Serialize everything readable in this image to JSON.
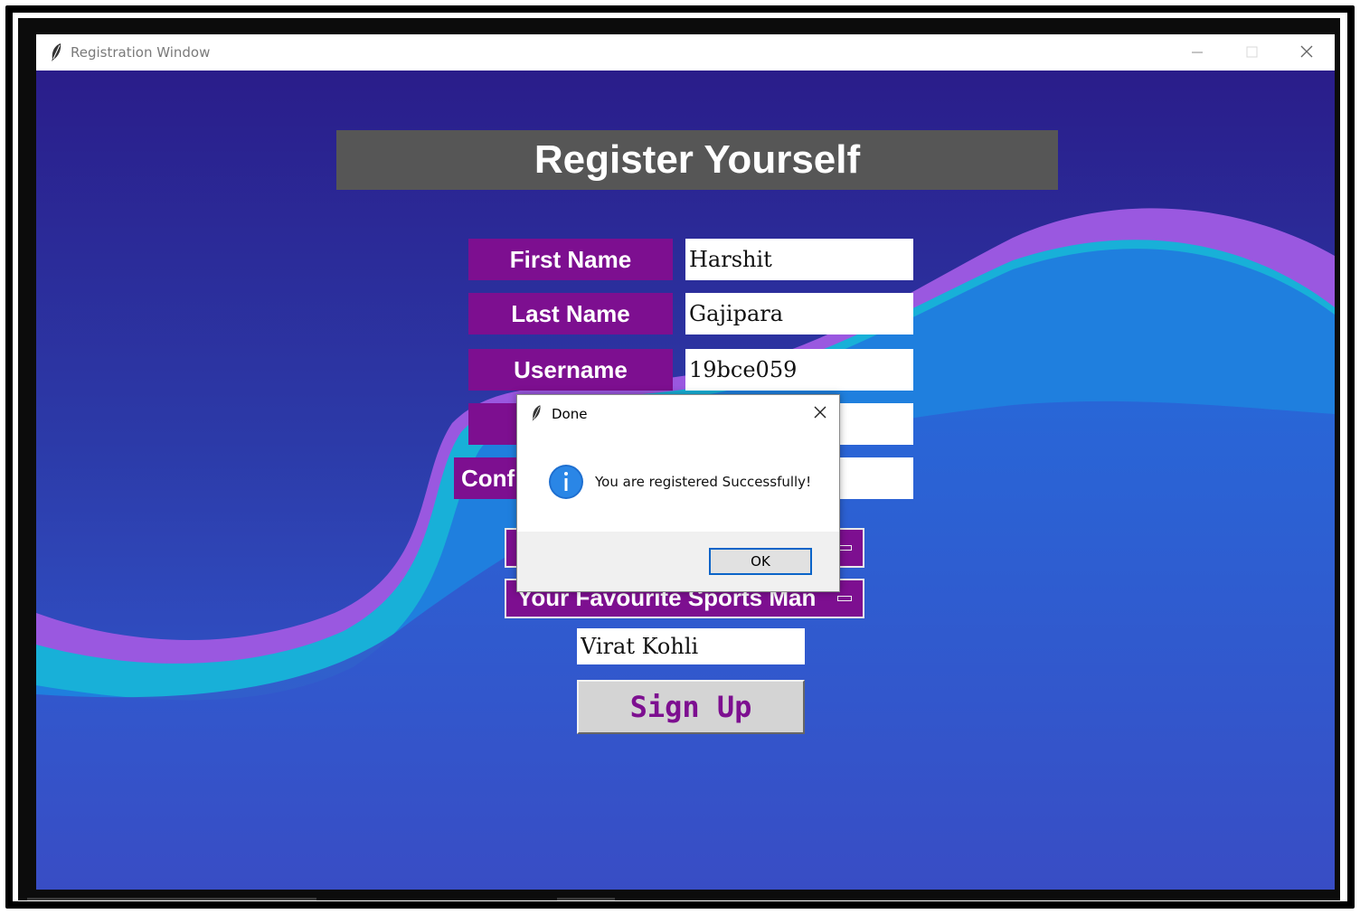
{
  "window": {
    "title": "Registration Window"
  },
  "form": {
    "heading": "Register Yourself",
    "first_name": {
      "label": "First Name",
      "value": "Harshit"
    },
    "last_name": {
      "label": "Last Name",
      "value": "Gajipara"
    },
    "username": {
      "label": "Username",
      "value": "19bce059"
    },
    "password": {
      "label": "",
      "value": ""
    },
    "confirm_password": {
      "label": "Conf",
      "value": ""
    },
    "menu_1": {
      "label": ""
    },
    "sports_menu": {
      "label": "Your Favourite Sports Man"
    },
    "sports_value": "Virat Kohli",
    "submit_label": "Sign Up"
  },
  "dialog": {
    "title": "Done",
    "message": "You are registered Successfully!",
    "ok_label": "OK",
    "icon": "info-icon"
  },
  "colors": {
    "label_bg": "#7d0f90",
    "heading_bg": "#565656",
    "background_top": "#2a1d8a",
    "background_bottom": "#3c45c0",
    "wave_cyan": "#18b0d8",
    "wave_purple": "#9a58e0",
    "wave_blue": "#1f7fde",
    "button_bg": "#d4d4d4",
    "button_text": "#7d0f90"
  }
}
